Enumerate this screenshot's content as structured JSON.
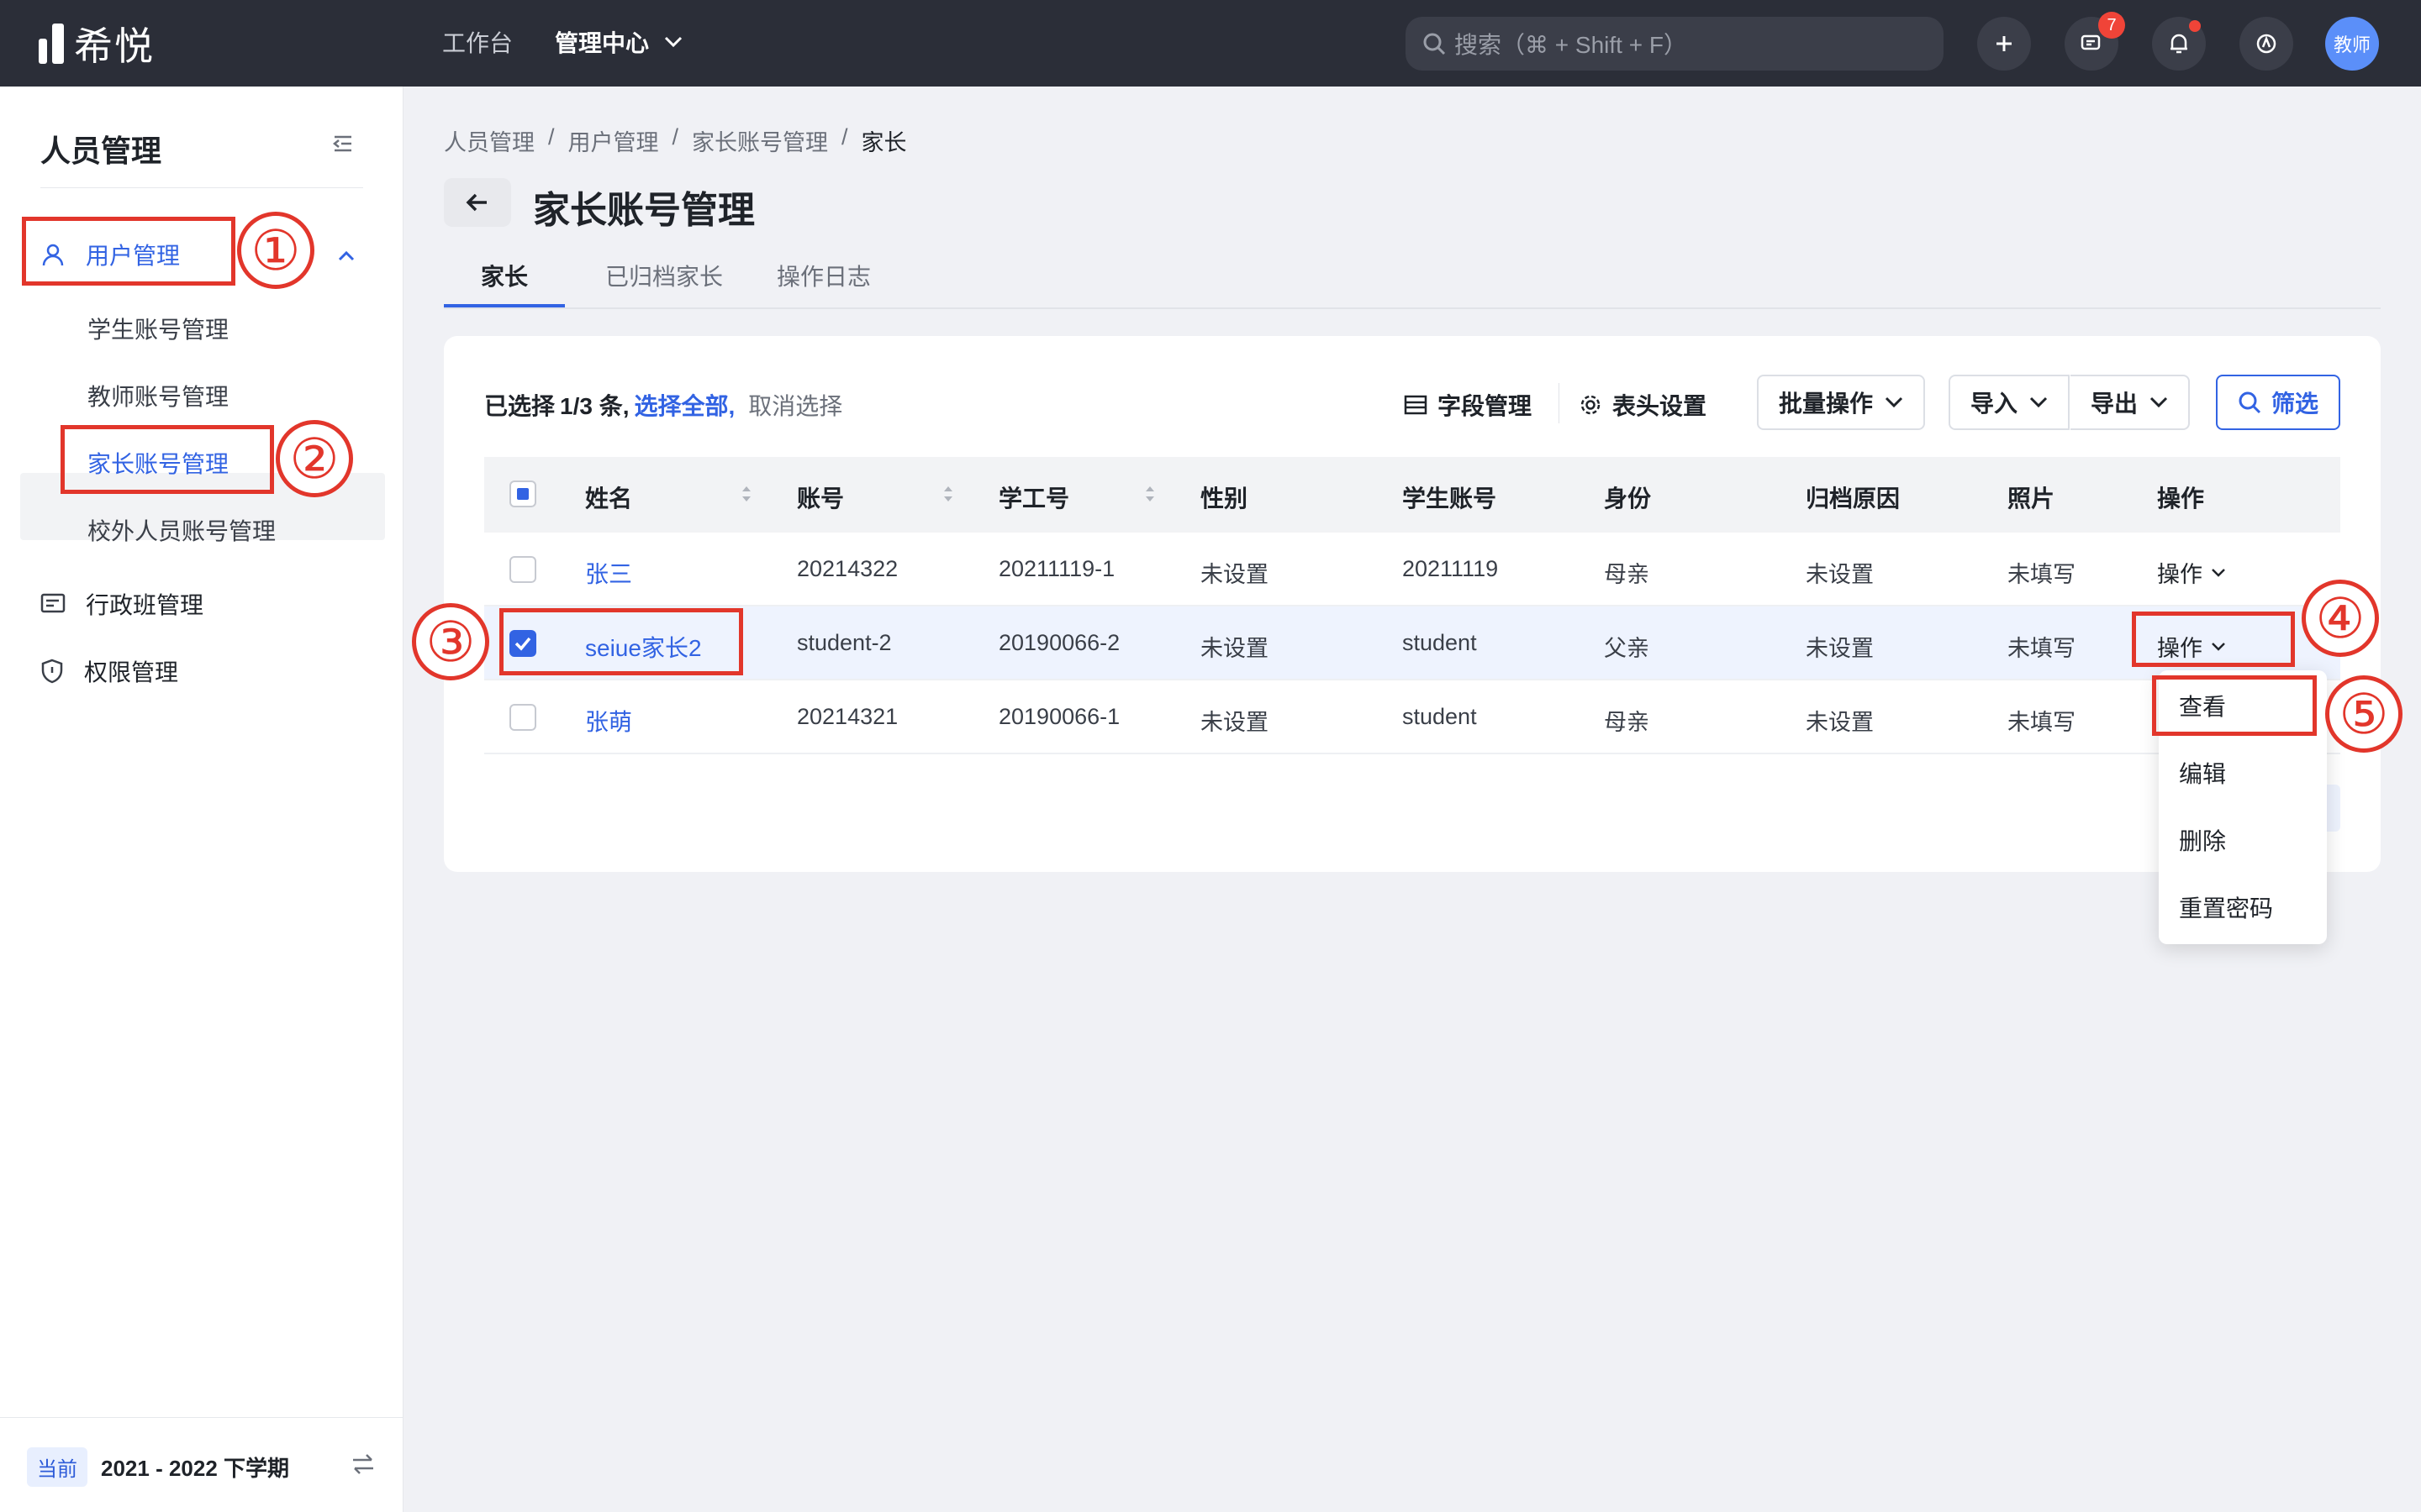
{
  "app": {
    "logo_text": "希悦",
    "nav": [
      "工作台",
      "管理中心"
    ],
    "search_placeholder": "搜索（⌘ + Shift + F）",
    "message_count": "7",
    "avatar_label": "教师"
  },
  "sidebar": {
    "title": "人员管理",
    "groups": [
      {
        "label": "用户管理",
        "children": [
          "学生账号管理",
          "教师账号管理",
          "家长账号管理",
          "校外人员账号管理"
        ]
      },
      {
        "label": "行政班管理"
      },
      {
        "label": "权限管理"
      }
    ],
    "term_badge": "当前",
    "term": "2021 - 2022 下学期"
  },
  "breadcrumb": [
    "人员管理",
    "用户管理",
    "家长账号管理",
    "家长"
  ],
  "page_title": "家长账号管理",
  "tabs": [
    "家长",
    "已归档家长",
    "操作日志"
  ],
  "toolbar": {
    "selected_prefix": "已选择",
    "selected_count": "1/3 条,",
    "select_all": "选择全部,",
    "cancel_select": "取消选择",
    "field_manage": "字段管理",
    "header_settings": "表头设置",
    "batch": "批量操作",
    "import": "导入",
    "export": "导出",
    "filter": "筛选"
  },
  "table": {
    "columns": [
      "姓名",
      "账号",
      "学工号",
      "性别",
      "学生账号",
      "身份",
      "归档原因",
      "照片",
      "操作"
    ],
    "rows": [
      {
        "name": "张三",
        "account": "20214322",
        "staff_id": "20211119-1",
        "gender": "未设置",
        "student_account": "20211119",
        "identity": "母亲",
        "archive_reason": "未设置",
        "photo": "未填写",
        "op": "操作"
      },
      {
        "name": "seiue家长2",
        "account": "student-2",
        "staff_id": "20190066-2",
        "gender": "未设置",
        "student_account": "student",
        "identity": "父亲",
        "archive_reason": "未设置",
        "photo": "未填写",
        "op": "操作"
      },
      {
        "name": "张萌",
        "account": "20214321",
        "staff_id": "20190066-1",
        "gender": "未设置",
        "student_account": "student",
        "identity": "母亲",
        "archive_reason": "未设置",
        "photo": "未填写",
        "op": "操作"
      }
    ]
  },
  "op_menu": [
    "查看",
    "编辑",
    "删除",
    "重置密码"
  ],
  "annotations": [
    "①",
    "②",
    "③",
    "④",
    "⑤"
  ],
  "colors": {
    "accent": "#3263e3",
    "annotation": "#e2362b",
    "topbar": "#2b2e38"
  }
}
